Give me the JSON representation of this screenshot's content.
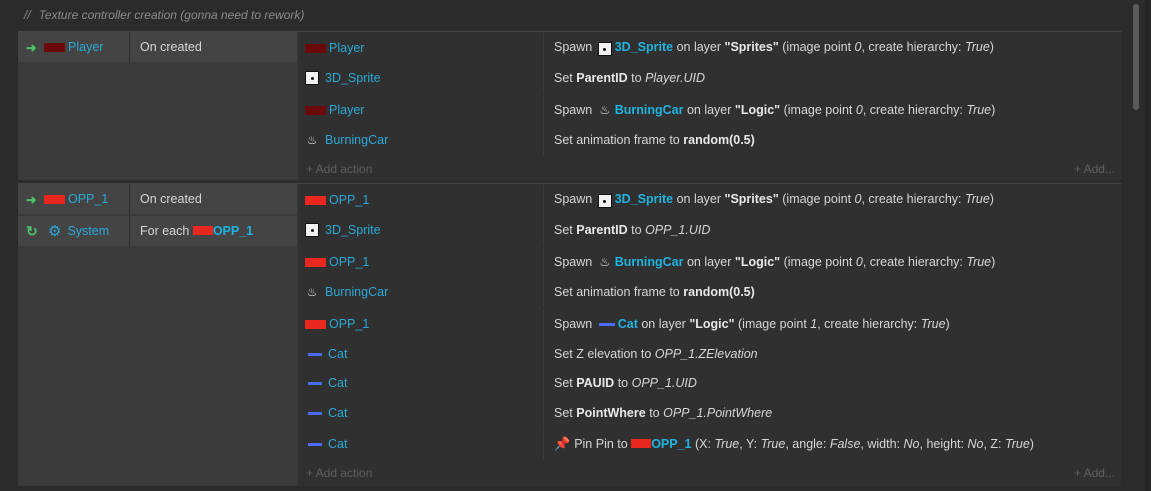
{
  "comment": {
    "prefix": "//",
    "text": "Texture controller creation (gonna need to rework)"
  },
  "common": {
    "add_action": "+ Add action",
    "add_right": "+ Add..."
  },
  "colors": {
    "player_swatch": "#6b0a0a",
    "opp_swatch": "#e8281e",
    "cat_swatch": "#4a6cf0",
    "object_link": "#2aa9d6"
  },
  "block1": {
    "cond1": {
      "object": "Player",
      "text": "On created",
      "icon": "right-arrow-icon"
    },
    "actions": [
      {
        "object": "Player",
        "icon": "player-swatch",
        "parts": [
          "Spawn",
          "3D_Sprite",
          "on layer",
          "\"Sprites\"",
          "(image point",
          "0",
          ", create hierarchy:",
          "True",
          ")"
        ]
      },
      {
        "object": "3D_Sprite",
        "icon": "sprite-icon",
        "parts": [
          "Set",
          "ParentID",
          "to",
          "Player.UID"
        ]
      },
      {
        "object": "Player",
        "icon": "player-swatch",
        "parts": [
          "Spawn",
          "BurningCar",
          "on layer",
          "\"Logic\"",
          "(image point",
          "0",
          ", create hierarchy:",
          "True",
          ")"
        ]
      },
      {
        "object": "BurningCar",
        "icon": "fire-icon",
        "parts": [
          "Set animation frame to",
          "random(0.5)"
        ]
      }
    ]
  },
  "block2": {
    "cond1": {
      "object": "OPP_1",
      "text": "On created",
      "icon": "right-arrow-icon"
    },
    "cond2": {
      "object": "System",
      "text": "For each",
      "target": "OPP_1",
      "icon": "loop-icon"
    },
    "actions": [
      {
        "object": "OPP_1",
        "icon": "opp-swatch",
        "parts": [
          "Spawn",
          "3D_Sprite",
          "on layer",
          "\"Sprites\"",
          "(image point",
          "0",
          ", create hierarchy:",
          "True",
          ")"
        ]
      },
      {
        "object": "3D_Sprite",
        "icon": "sprite-icon",
        "parts": [
          "Set",
          "ParentID",
          "to",
          "OPP_1.UID"
        ]
      },
      {
        "object": "OPP_1",
        "icon": "opp-swatch",
        "parts": [
          "Spawn",
          "BurningCar",
          "on layer",
          "\"Logic\"",
          "(image point",
          "0",
          ", create hierarchy:",
          "True",
          ")"
        ]
      },
      {
        "object": "BurningCar",
        "icon": "fire-icon",
        "parts": [
          "Set animation frame to",
          "random(0.5)"
        ]
      },
      {
        "object": "OPP_1",
        "icon": "opp-swatch",
        "parts": [
          "Spawn",
          "Cat",
          "on layer",
          "\"Logic\"",
          "(image point",
          "1",
          ", create hierarchy:",
          "True",
          ")"
        ]
      },
      {
        "object": "Cat",
        "icon": "cat-swatch",
        "parts": [
          "Set Z elevation to",
          "OPP_1.ZElevation"
        ]
      },
      {
        "object": "Cat",
        "icon": "cat-swatch",
        "parts": [
          "Set",
          "PAUID",
          "to",
          "OPP_1.UID"
        ]
      },
      {
        "object": "Cat",
        "icon": "cat-swatch",
        "parts": [
          "Set",
          "PointWhere",
          "to",
          "OPP_1.PointWhere"
        ]
      },
      {
        "object": "Cat",
        "icon": "cat-swatch",
        "parts": [
          "Pin Pin to",
          "OPP_1",
          "(X:",
          "True",
          ", Y:",
          "True",
          ", angle:",
          "False",
          ", width:",
          "No",
          ", height:",
          "No",
          ", Z:",
          "True",
          ")"
        ]
      }
    ]
  }
}
